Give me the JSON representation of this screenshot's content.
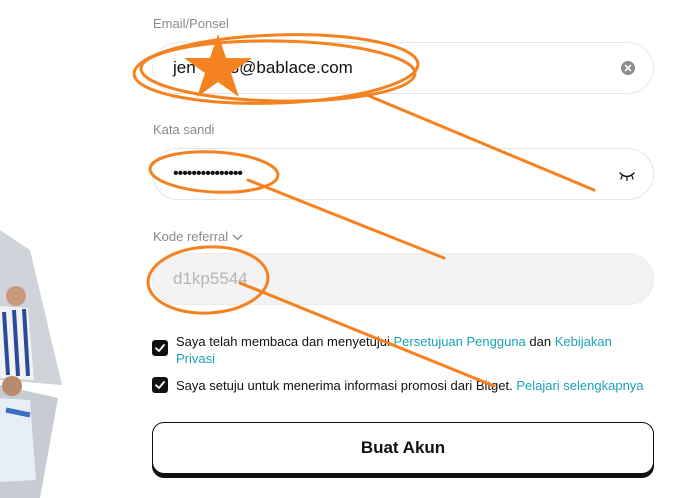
{
  "form": {
    "email": {
      "label": "Email/Ponsel",
      "value": "jen          3@bablace.com"
    },
    "password": {
      "label": "Kata sandi",
      "value": "•••••••••••••••"
    },
    "referral": {
      "label": "Kode referral",
      "value": "d1kp5544"
    },
    "agree_terms": {
      "checked": true,
      "text_1": "Saya telah membaca dan menyetujui ",
      "link_1": "Persetujuan Pengguna",
      "text_2": " dan ",
      "link_2": "Kebijakan",
      "link_2b": "Privasi"
    },
    "agree_promo": {
      "checked": true,
      "text": "Saya setuju untuk menerima informasi promosi dari Bitget. ",
      "link": "Pelajari selengkapnya"
    },
    "submit_label": "Buat Akun"
  },
  "colors": {
    "link": "#1aa3b4",
    "annotation": "#f58220",
    "checkbox": "#111111"
  },
  "icons": {
    "email_clear": "clear-circle-icon",
    "password_toggle": "eye-closed-icon",
    "referral_toggle": "chevron-down-icon"
  }
}
